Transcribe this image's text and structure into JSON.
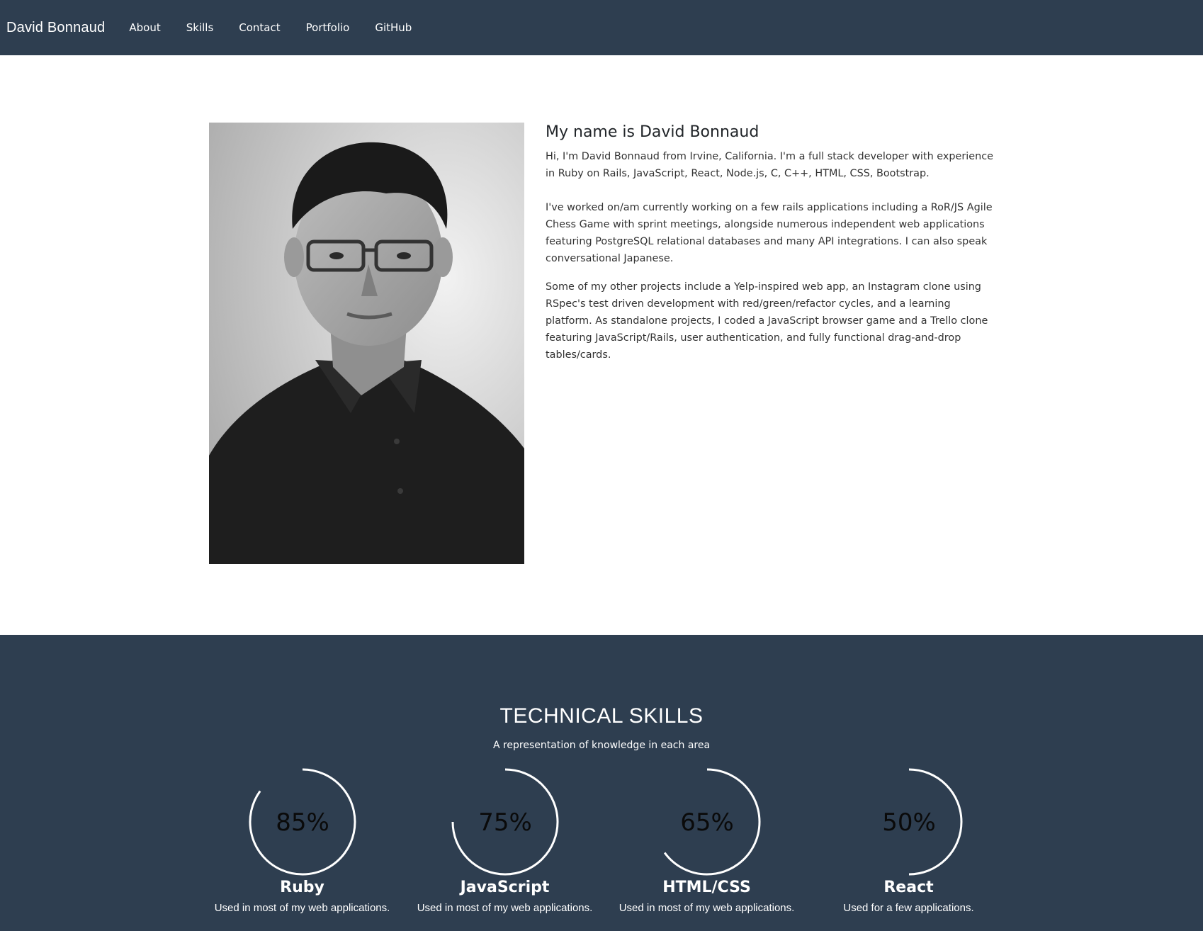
{
  "nav": {
    "brand": "David Bonnaud",
    "links": [
      "About",
      "Skills",
      "Contact",
      "Portfolio",
      "GitHub"
    ]
  },
  "about": {
    "heading": "My name is David Bonnaud",
    "paragraphs": [
      "Hi, I'm David Bonnaud from Irvine, California. I'm a full stack developer with experience in Ruby on Rails, JavaScript, React, Node.js, C, C++, HTML, CSS, Bootstrap.",
      "I've worked on/am currently working on a few rails applications including a RoR/JS Agile Chess Game with sprint meetings, alongside numerous independent web applications featuring PostgreSQL relational databases and many API integrations. I can also speak conversational Japanese.",
      "Some of my other projects include a Yelp-inspired web app, an Instagram clone using RSpec's test driven development with red/green/refactor cycles, and a learning platform. As standalone projects, I coded a JavaScript browser game and a Trello clone featuring JavaScript/Rails, user authentication, and fully functional drag-and-drop tables/cards."
    ]
  },
  "skills": {
    "title": "TECHNICAL SKILLS",
    "subtitle": "A representation of knowledge in each area",
    "items": [
      {
        "name": "Ruby",
        "percent_label": "85%",
        "level": 0.85,
        "description": "Used in most of my web applications."
      },
      {
        "name": "JavaScript",
        "percent_label": "75%",
        "level": 0.75,
        "description": "Used in most of my web applications."
      },
      {
        "name": "HTML/CSS",
        "percent_label": "65%",
        "level": 0.65,
        "description": "Used in most of my web applications."
      },
      {
        "name": "React",
        "percent_label": "50%",
        "level": 0.5,
        "description": "Used for a few applications."
      }
    ]
  },
  "colors": {
    "nav_bg": "#2e3e50",
    "ring": "#ffffff",
    "percent_text": "#0a0a0a"
  }
}
